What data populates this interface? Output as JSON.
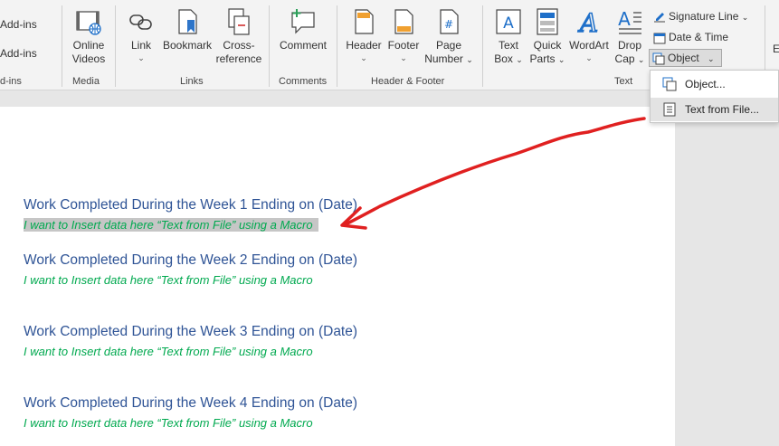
{
  "ribbon": {
    "addins": {
      "item1": "Add-ins",
      "item2": "Add-ins",
      "group": "d-ins"
    },
    "media": {
      "online_videos_line1": "Online",
      "online_videos_line2": "Videos",
      "group": "Media"
    },
    "links": {
      "link": "Link",
      "bookmark": "Bookmark",
      "crossref_line1": "Cross-",
      "crossref_line2": "reference",
      "group": "Links"
    },
    "comments": {
      "comment": "Comment",
      "group": "Comments"
    },
    "header_footer": {
      "header": "Header",
      "footer": "Footer",
      "page_number_line1": "Page",
      "page_number_line2": "Number",
      "group": "Header & Footer"
    },
    "text": {
      "text_box_line1": "Text",
      "text_box_line2": "Box",
      "quick_parts_line1": "Quick",
      "quick_parts_line2": "Parts",
      "wordart": "WordArt",
      "drop_cap_line1": "Drop",
      "drop_cap_line2": "Cap",
      "signature_line": "Signature Line",
      "date_time": "Date & Time",
      "object": "Object",
      "group": "Text"
    },
    "cut_letter": "E"
  },
  "object_menu": {
    "items": [
      "Object...",
      "Text from File..."
    ]
  },
  "document": {
    "sections": [
      {
        "heading": "Work Completed During the Week 1 Ending on (Date)",
        "note": "I want to Insert data here “Text from File” using a Macro"
      },
      {
        "heading": "Work Completed During the Week 2 Ending on (Date)",
        "note": "I want to Insert data here “Text from File” using a Macro"
      },
      {
        "heading": "Work Completed During the Week 3 Ending on (Date)",
        "note": "I want to Insert data here “Text from File” using a Macro"
      },
      {
        "heading": "Work Completed During the Week 4 Ending on (Date)",
        "note": "I want to Insert data here “Text from File” using a Macro"
      }
    ]
  },
  "colors": {
    "heading": "#2f5496",
    "note": "#00a94f",
    "arrow": "#e02020",
    "selection": "#c6c6c6"
  }
}
